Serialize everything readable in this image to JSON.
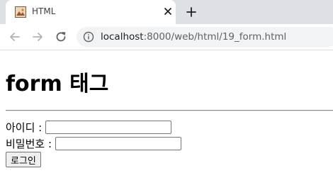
{
  "browser": {
    "tab": {
      "title": "HTML",
      "favicon_icon": "html-image-icon"
    },
    "address_bar": {
      "host": "localhost",
      "path": ":8000/web/html/19_form.html"
    }
  },
  "page": {
    "heading": "form 태그",
    "form": {
      "id_label": "아이디 :",
      "id_value": "",
      "password_label": "비밀번호 :",
      "password_value": "",
      "submit_label": "로그인"
    }
  }
}
